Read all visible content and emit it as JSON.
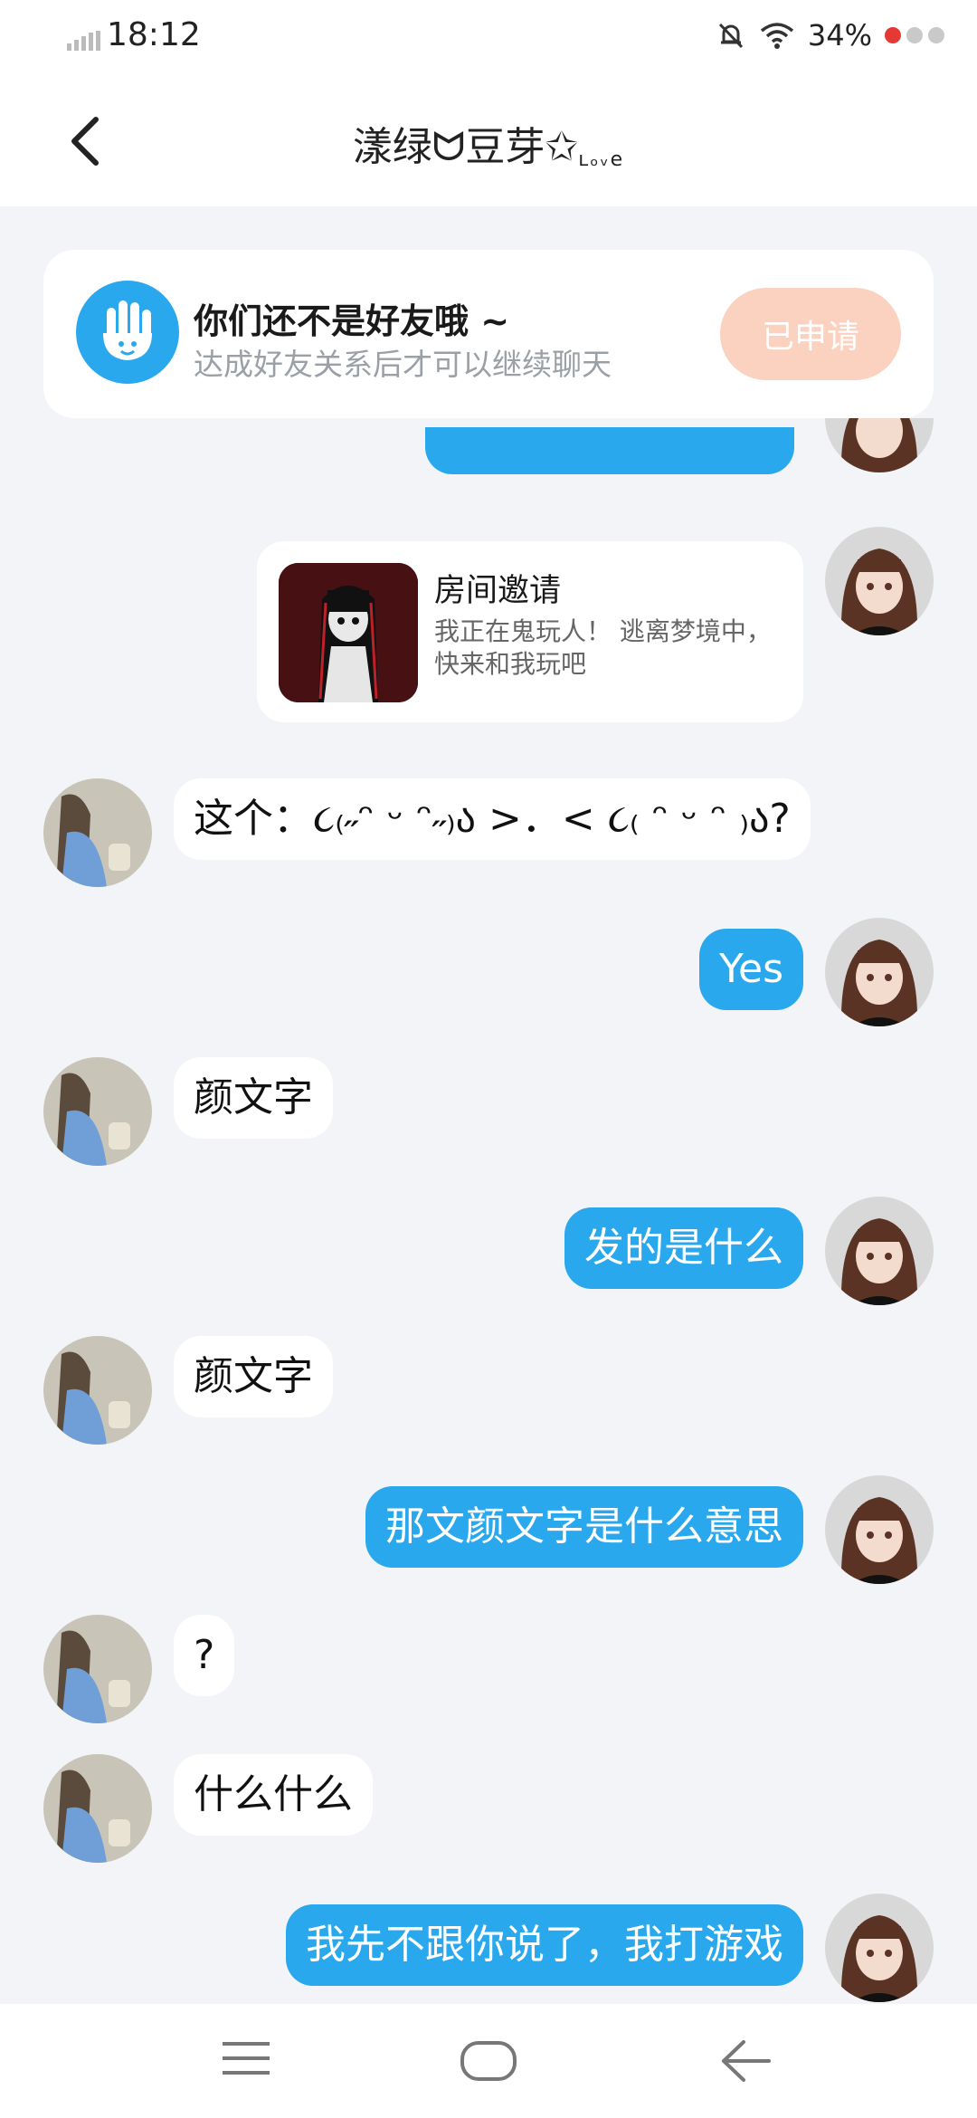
{
  "status_bar": {
    "time": "18:12",
    "battery_percent": "34%"
  },
  "header": {
    "title": "漾绿ᗢ豆芽✩",
    "title_suffix": "ʟₒᵥe"
  },
  "friend_notice": {
    "title": "你们还不是好友哦 ~",
    "subtitle": "达成好友关系后才可以继续聊天",
    "button_label": "已申请"
  },
  "room_invite": {
    "title": "房间邀请",
    "description": "我正在鬼玩人！ 逃离梦境中，快来和我玩吧"
  },
  "messages": [
    {
      "side": "in",
      "text": "这个：૮₍˶ᵔ ᵕ ᵔ˶₎ა >．< ૮₍ ᵔ ᵕ ᵔ ₎ა?"
    },
    {
      "side": "out",
      "text": "Yes"
    },
    {
      "side": "in",
      "text": "颜文字"
    },
    {
      "side": "out",
      "text": "发的是什么"
    },
    {
      "side": "in",
      "text": "颜文字"
    },
    {
      "side": "out",
      "text": "那文颜文字是什么意思"
    },
    {
      "side": "in",
      "text": "?"
    },
    {
      "side": "in",
      "text": "什么什么"
    },
    {
      "side": "out",
      "text": "我先不跟你说了，我打游戏"
    }
  ],
  "colors": {
    "accent": "#2aa8ee",
    "applied_button": "#fbd1c0",
    "background": "#f2f4f7"
  },
  "icons": {
    "back": "chevron-left-icon",
    "wave": "waving-hand-icon",
    "menu": "menu-lines-icon",
    "home": "home-rounded-rect-icon",
    "nav_back": "arrow-left-icon"
  }
}
